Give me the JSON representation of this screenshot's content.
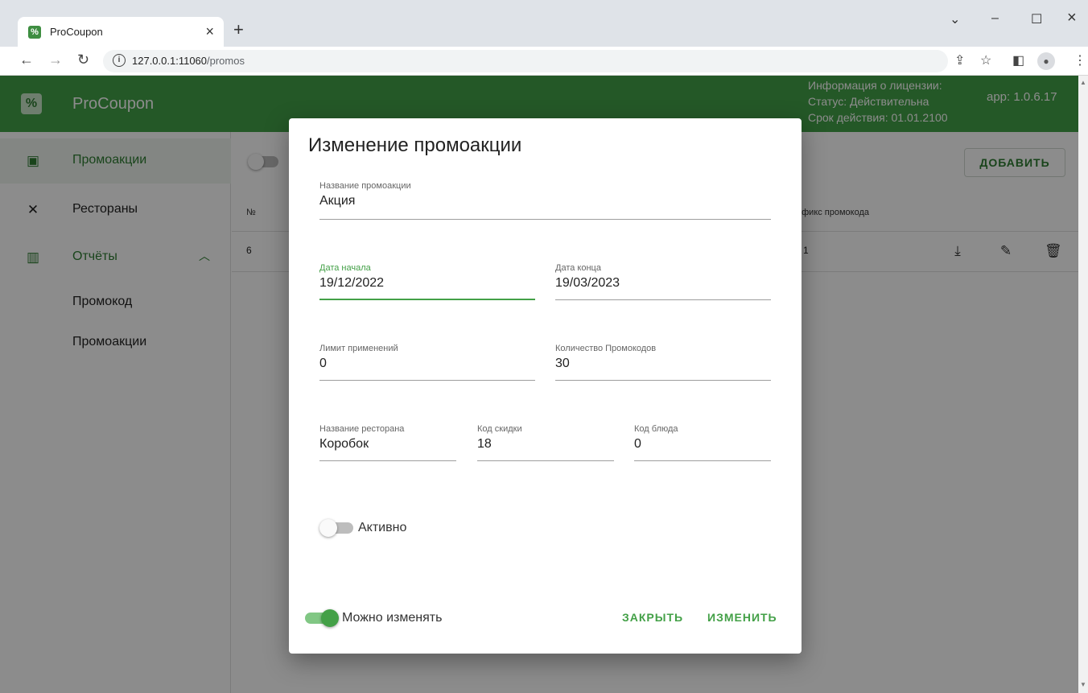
{
  "browser": {
    "tab_title": "ProCoupon",
    "tab_close": "×",
    "new_tab": "+",
    "url_host": "127.0.0.1:11060",
    "url_path": "/promos",
    "win_minimize": "–",
    "win_maximize": "☐",
    "win_close": "×",
    "tab_menu": "⌄"
  },
  "header": {
    "app_title": "ProCoupon",
    "license_title": "Информация о лицензии:",
    "license_status": "Статус: Действительна",
    "license_expiry": "Срок действия: 01.01.2100",
    "app_version": "app: 1.0.6.17"
  },
  "sidebar": {
    "items": [
      {
        "label": "Промоакции"
      },
      {
        "label": "Рестораны"
      },
      {
        "label": "Отчёты"
      }
    ],
    "sub_items": [
      {
        "label": "Промокод"
      },
      {
        "label": "Промоакции"
      }
    ]
  },
  "main": {
    "add_label": "ДОБАВИТЬ",
    "columns": {
      "num": "№",
      "prefix": "ефикс промокода"
    },
    "rows": [
      {
        "num": "6",
        "prefix": "1"
      }
    ]
  },
  "dialog": {
    "title": "Изменение промоакции",
    "promo_name": {
      "label": "Название промоакции",
      "value": "Акция"
    },
    "start_date": {
      "label": "Дата начала",
      "value": "19/12/2022"
    },
    "end_date": {
      "label": "Дата конца",
      "value": "19/03/2023"
    },
    "usage_limit": {
      "label": "Лимит применений",
      "value": "0"
    },
    "promo_count": {
      "label": "Количество Промокодов",
      "value": "30"
    },
    "restaurant": {
      "label": "Название ресторана",
      "value": "Коробок"
    },
    "discount_code": {
      "label": "Код скидки",
      "value": "18"
    },
    "dish_code": {
      "label": "Код блюда",
      "value": "0"
    },
    "active_label": "Активно",
    "active_on": false,
    "editable_label": "Можно изменять",
    "editable_on": true,
    "close_label": "ЗАКРЫТЬ",
    "submit_label": "ИЗМЕНИТЬ"
  },
  "colors": {
    "brand_green": "#43a047",
    "dark_green": "#2e7d32"
  }
}
